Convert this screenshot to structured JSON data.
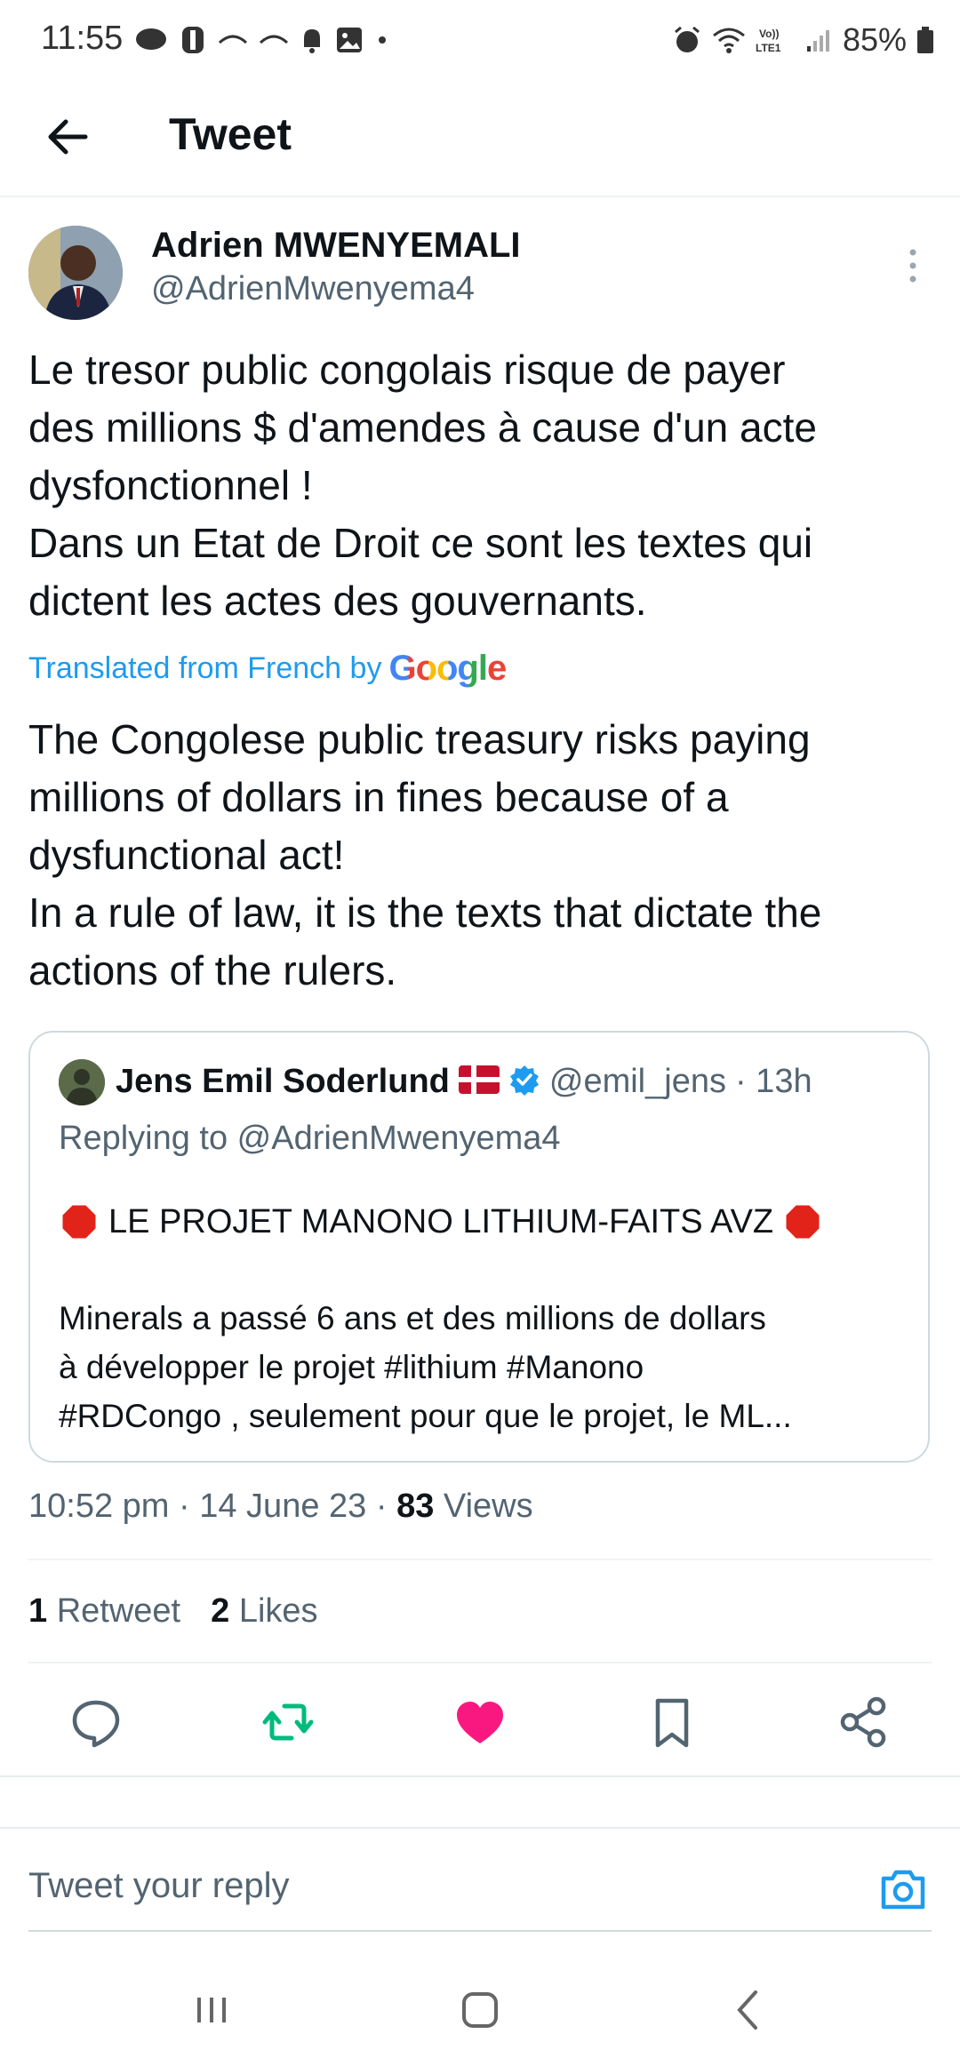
{
  "status_bar": {
    "time": "11:55",
    "battery": "85%"
  },
  "header": {
    "title": "Tweet"
  },
  "tweet": {
    "author_name": "Adrien MWENYEMALI",
    "author_handle": "@AdrienMwenyema4",
    "text": "Le tresor public congolais risque de payer\ndes millions $ d'amendes à cause d'un acte\ndysfonctionnel !\nDans un Etat de Droit ce sont les textes qui\ndictent les actes des gouvernants.",
    "translated_label": "Translated from French by",
    "translation_provider": "Google",
    "translation": "The Congolese public treasury risks paying\nmillions of dollars in fines because of a\ndysfunctional act!\nIn a rule of law, it is the texts that dictate the\nactions of the rulers."
  },
  "quote": {
    "name": "Jens Emil Soderlund",
    "flag": "🇩🇰",
    "handle": "@emil_jens",
    "time": "· 13h",
    "replying_to": "Replying to @AdrienMwenyema4",
    "title": "LE PROJET MANONO LITHIUM-FAITS AVZ",
    "body": "Minerals a passé 6 ans et des millions de dollars\nà développer le projet #lithium #Manono\n#RDCongo , seulement pour que le projet, le ML..."
  },
  "meta": {
    "time": "10:52 pm",
    "date": "14 June 23",
    "views_count": "83",
    "views_label": "Views"
  },
  "stats": {
    "retweets_count": "1",
    "retweets_label": "Retweet",
    "likes_count": "2",
    "likes_label": "Likes"
  },
  "reply": {
    "placeholder": "Tweet your reply"
  },
  "colors": {
    "accent": "#1d9bf0",
    "retweet": "#00ba7c",
    "like": "#f91880"
  }
}
